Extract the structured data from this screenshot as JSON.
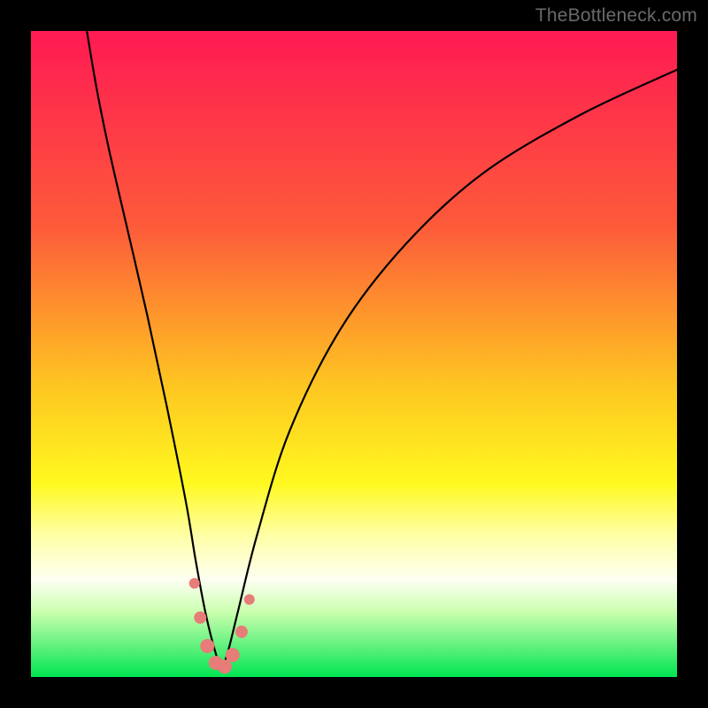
{
  "watermark": "TheBottleneck.com",
  "chart_data": {
    "type": "line",
    "title": "",
    "xlabel": "",
    "ylabel": "",
    "xlim": [
      0,
      100
    ],
    "ylim": [
      0,
      100
    ],
    "gradient_stops": [
      {
        "offset": 0,
        "color": "#ff1a53"
      },
      {
        "offset": 30,
        "color": "#fd5a3a"
      },
      {
        "offset": 55,
        "color": "#fec621"
      },
      {
        "offset": 70,
        "color": "#fff91f"
      },
      {
        "offset": 78,
        "color": "#ffffa5"
      },
      {
        "offset": 85,
        "color": "#fdfff2"
      },
      {
        "offset": 90,
        "color": "#c9ffad"
      },
      {
        "offset": 100,
        "color": "#00e552"
      }
    ],
    "series": [
      {
        "name": "bottleneck-curve",
        "x": [
          8,
          10,
          12,
          15,
          18,
          21,
          24,
          25.5,
          27,
          28.5,
          29.5,
          30.5,
          32,
          35,
          40,
          48,
          58,
          70,
          85,
          100
        ],
        "y": [
          104,
          92,
          82,
          69,
          56,
          42,
          27,
          18,
          10,
          4,
          1.5,
          4,
          10,
          22,
          38,
          54,
          67,
          78,
          87,
          94
        ]
      }
    ],
    "markers": {
      "name": "highlight-points",
      "color": "#e77c78",
      "points": [
        {
          "x": 25.3,
          "y": 14.5,
          "r": 6
        },
        {
          "x": 26.2,
          "y": 9.2,
          "r": 7
        },
        {
          "x": 27.3,
          "y": 4.8,
          "r": 8
        },
        {
          "x": 28.6,
          "y": 2.2,
          "r": 8
        },
        {
          "x": 30.0,
          "y": 1.6,
          "r": 8
        },
        {
          "x": 31.2,
          "y": 3.4,
          "r": 8
        },
        {
          "x": 32.6,
          "y": 7.0,
          "r": 7
        },
        {
          "x": 33.8,
          "y": 12.0,
          "r": 6
        }
      ]
    }
  }
}
